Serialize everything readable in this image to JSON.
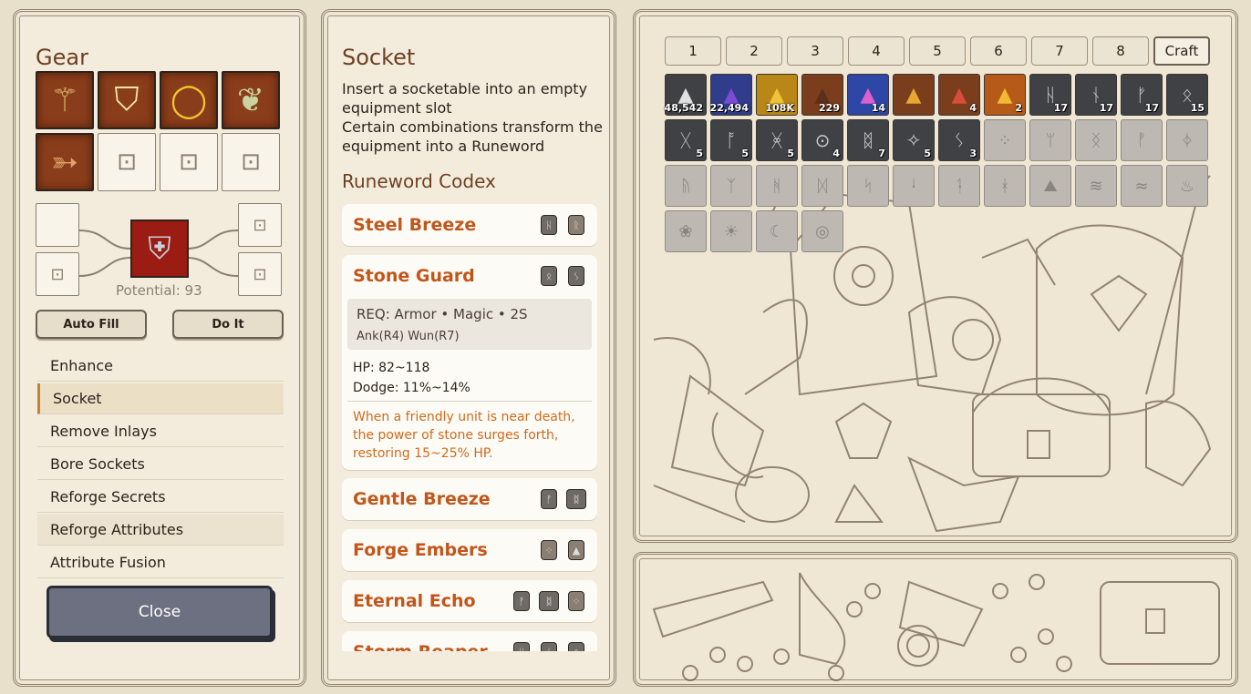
{
  "left": {
    "title": "Gear",
    "gear_slots": [
      {
        "icon": "staff-icon",
        "glyph": "⚚",
        "state": "filled",
        "color": "#d9b26a"
      },
      {
        "icon": "shield-icon",
        "glyph": "⛉",
        "state": "filled",
        "color": "#f4e7a8"
      },
      {
        "icon": "ring-icon",
        "glyph": "◯",
        "state": "filled",
        "color": "#f3c52d"
      },
      {
        "icon": "fang-icon",
        "glyph": "❦",
        "state": "filled",
        "color": "#c9d2a0"
      },
      {
        "icon": "bow-icon",
        "glyph": "➳",
        "state": "filled",
        "color": "#e0a46a"
      },
      {
        "icon": "lock-icon",
        "glyph": "🔒",
        "state": "locked"
      },
      {
        "icon": "lock-icon",
        "glyph": "🔒",
        "state": "locked"
      },
      {
        "icon": "lock-icon",
        "glyph": "🔒",
        "state": "locked"
      }
    ],
    "potential_label": "Potential: 93",
    "auto_fill": "Auto Fill",
    "do_it": "Do It",
    "menu": [
      {
        "label": "Enhance",
        "state": ""
      },
      {
        "label": "Socket",
        "state": "active"
      },
      {
        "label": "Remove Inlays",
        "state": ""
      },
      {
        "label": "Bore Sockets",
        "state": ""
      },
      {
        "label": "Reforge Secrets",
        "state": ""
      },
      {
        "label": "Reforge Attributes",
        "state": "shaded"
      },
      {
        "label": "Attribute Fusion",
        "state": ""
      }
    ],
    "close": "Close"
  },
  "center": {
    "title": "Socket",
    "description": "Insert a socketable into an empty equipment slot\nCertain combinations transform the equipment into a Runeword",
    "desc_line1": "Insert a socketable into an empty",
    "desc_line2": "equipment slot",
    "desc_line3": "Certain combinations transform the",
    "desc_line4": "equipment into a Runeword",
    "codex_title": "Runeword Codex",
    "runewords": [
      {
        "name": "Steel Breeze"
      },
      {
        "name": "Stone Guard",
        "req": "REQ: Armor  •  Magic  •  2S",
        "req_runes": "Ank(R4)  Wun(R7)",
        "hp": "HP: 82~118",
        "dodge": "Dodge: 11%~14%",
        "flavor": "When a friendly unit is near death, the power of stone surges forth, restoring 15~25% HP."
      },
      {
        "name": "Gentle Breeze"
      },
      {
        "name": "Forge Embers"
      },
      {
        "name": "Eternal Echo"
      },
      {
        "name": "Storm Reaper"
      }
    ]
  },
  "right": {
    "tabs": [
      "1",
      "2",
      "3",
      "4",
      "5",
      "6",
      "7",
      "8"
    ],
    "craft": "Craft",
    "materials": [
      {
        "name": "salt-pile-icon",
        "qty": "48,542",
        "bg": "#3f4144",
        "color": "#e0e0e0"
      },
      {
        "name": "purple-dust-icon",
        "qty": "22,494",
        "bg": "#2f3d8a",
        "color": "#7c4bd6"
      },
      {
        "name": "gold-dust-icon",
        "qty": "108K",
        "bg": "#b88717",
        "color": "#f0c23a"
      },
      {
        "name": "dirt-pile-icon",
        "qty": "229",
        "bg": "#7a3e1c",
        "color": "#5b2f1a"
      },
      {
        "name": "pink-slime-icon",
        "qty": "14",
        "bg": "#2e46a5",
        "color": "#e05fd0"
      },
      {
        "name": "unicorn-horn-icon",
        "qty": "",
        "bg": "#7a3e1c",
        "color": "#e8a632"
      },
      {
        "name": "dragon-scale-icon",
        "qty": "4",
        "bg": "#7a3e1c",
        "color": "#d84c3a"
      },
      {
        "name": "gold-ore-icon",
        "qty": "2",
        "bg": "#b55a18",
        "color": "#f2b934"
      },
      {
        "name": "rune-dark-1",
        "qty": "17",
        "glyph": "ᚺ"
      },
      {
        "name": "rune-dark-2",
        "qty": "17",
        "glyph": "ᚾ"
      },
      {
        "name": "rune-dark-3",
        "qty": "17",
        "glyph": "ᚠ"
      },
      {
        "name": "rune-dark-4",
        "qty": "15",
        "glyph": "ᛟ"
      }
    ],
    "runes_row2": [
      {
        "glyph": "ᚷ",
        "qty": "5"
      },
      {
        "glyph": "ᚩ",
        "qty": "5"
      },
      {
        "glyph": "ᚸ",
        "qty": "5"
      },
      {
        "glyph": "⊙",
        "qty": "4"
      },
      {
        "glyph": "ᛥ",
        "qty": "7"
      },
      {
        "glyph": "✧",
        "qty": "5"
      },
      {
        "glyph": "ᛊ",
        "qty": "3"
      },
      {
        "glyph": "⁘",
        "qty": ""
      },
      {
        "glyph": "ᛘ",
        "qty": ""
      },
      {
        "glyph": "ᛝ",
        "qty": ""
      },
      {
        "glyph": "ᚡ",
        "qty": ""
      },
      {
        "glyph": "ᛄ",
        "qty": ""
      }
    ],
    "runes_row3": [
      "ᚥ",
      "ᛉ",
      "ᚻ",
      "ᛞ",
      "ᛋ",
      "ᛍ",
      "ᛑ",
      "ᚼ",
      "⛰",
      "≋",
      "≈",
      "♨"
    ],
    "runes_row4": [
      "❀",
      "☀",
      "☾",
      "◎"
    ]
  }
}
